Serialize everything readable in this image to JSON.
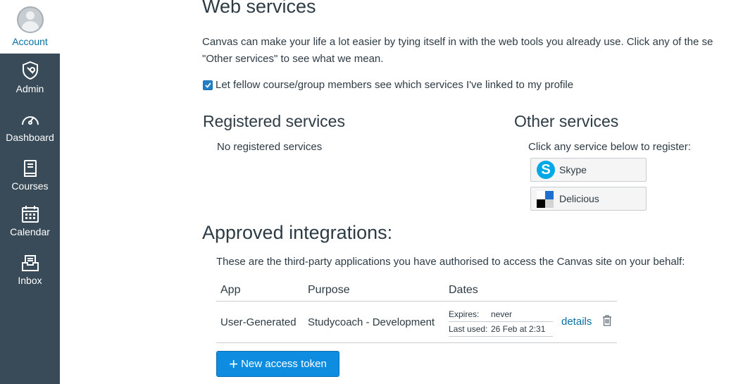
{
  "sidebar": {
    "items": [
      {
        "label": "Account",
        "icon": "avatar"
      },
      {
        "label": "Admin",
        "icon": "admin-shield-icon"
      },
      {
        "label": "Dashboard",
        "icon": "dashboard-gauge-icon"
      },
      {
        "label": "Courses",
        "icon": "courses-book-icon"
      },
      {
        "label": "Calendar",
        "icon": "calendar-icon"
      },
      {
        "label": "Inbox",
        "icon": "inbox-icon"
      }
    ],
    "colors": {
      "background": "#394b58",
      "active_text": "#0770a3"
    }
  },
  "page": {
    "title": "Web services",
    "intro_line1": "Canvas can make your life a lot easier by tying itself in with the web tools you already use. Click any of the se",
    "intro_line2": "\"Other services\" to see what we mean.",
    "share_checkbox_label": "Let fellow course/group members see which services I've linked to my profile",
    "share_checkbox_checked": true
  },
  "registered": {
    "title": "Registered services",
    "empty_text": "No registered services"
  },
  "other": {
    "title": "Other services",
    "hint": "Click any service below to register:",
    "services": [
      {
        "label": "Skype",
        "icon": "skype-icon"
      },
      {
        "label": "Delicious",
        "icon": "delicious-icon"
      }
    ]
  },
  "approved": {
    "title": "Approved integrations:",
    "description": "These are the third-party applications you have authorised to access the Canvas site on your behalf:",
    "columns": [
      "App",
      "Purpose",
      "Dates"
    ],
    "rows": [
      {
        "app": "User-Generated",
        "purpose": "Studycoach - Development",
        "expires_label": "Expires:",
        "expires_value": "never",
        "last_used_label": "Last used:",
        "last_used_value": "26 Feb at 2:31",
        "details_label": "details"
      }
    ],
    "new_token_label": "New access token"
  },
  "colors": {
    "primary": "#0d8ce0",
    "link": "#0770a3",
    "text": "#2d3b45"
  }
}
